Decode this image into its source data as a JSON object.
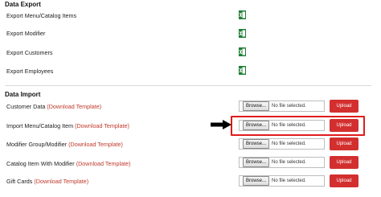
{
  "export": {
    "title": "Data Export",
    "items": [
      {
        "label": "Export Menu/Catalog Items",
        "icon": "excel-icon"
      },
      {
        "label": "Export Modifier",
        "icon": "excel-icon"
      },
      {
        "label": "Export Customers",
        "icon": "excel-icon"
      },
      {
        "label": "Export Employees",
        "icon": "excel-icon"
      }
    ]
  },
  "import": {
    "title": "Data Import",
    "browse_label": "Browse...",
    "no_file_text": "No file selected.",
    "upload_label": "Upload",
    "rows": [
      {
        "label": "Customer Data",
        "link": "(Download Template)"
      },
      {
        "label": "Import Menu/Catalog Item",
        "link": "(Download Template)"
      },
      {
        "label": "Modifier Group/Modifier",
        "link": "(Download Template)"
      },
      {
        "label": "Catalog Item With Modifier",
        "link": "(Download Template)"
      },
      {
        "label": "Gift Cards",
        "link": "(Download Template)"
      }
    ]
  },
  "annotation": {
    "arrow_icon": "arrow-right-icon",
    "highlight_color": "#e01b1b"
  },
  "colors": {
    "accent": "#d32f2f",
    "excel_green": "#1e7e34",
    "link": "#c0392b"
  }
}
